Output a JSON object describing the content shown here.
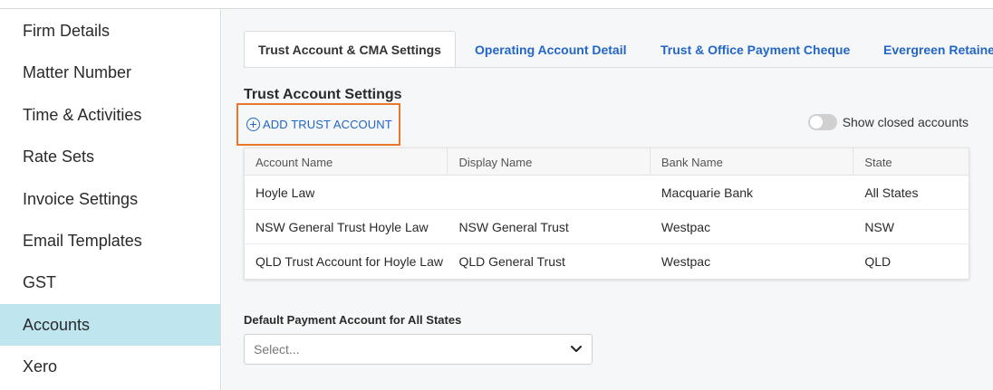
{
  "sidebar": {
    "items": [
      {
        "label": "Firm Details"
      },
      {
        "label": "Matter Number"
      },
      {
        "label": "Time & Activities"
      },
      {
        "label": "Rate Sets"
      },
      {
        "label": "Invoice Settings"
      },
      {
        "label": "Email Templates"
      },
      {
        "label": "GST"
      },
      {
        "label": "Accounts",
        "active": true
      },
      {
        "label": "Xero"
      }
    ]
  },
  "tabs": [
    {
      "label": "Trust Account & CMA Settings",
      "active": true
    },
    {
      "label": "Operating Account Detail"
    },
    {
      "label": "Trust & Office Payment Cheque"
    },
    {
      "label": "Evergreen Retainer"
    }
  ],
  "section": {
    "title": "Trust Account Settings",
    "add_button": "ADD TRUST ACCOUNT",
    "toggle_label": "Show closed accounts",
    "toggle_on": false
  },
  "table": {
    "headers": [
      "Account Name",
      "Display Name",
      "Bank Name",
      "State"
    ],
    "rows": [
      [
        "Hoyle Law",
        "",
        "Macquarie Bank",
        "All States"
      ],
      [
        "NSW General Trust Hoyle Law",
        "NSW General Trust",
        "Westpac",
        "NSW"
      ],
      [
        "QLD Trust Account for Hoyle Law",
        "QLD General Trust",
        "Westpac",
        "QLD"
      ]
    ]
  },
  "default_payment": {
    "label": "Default Payment Account for All States",
    "placeholder": "Select..."
  },
  "colors": {
    "accent_blue": "#2366c5",
    "active_sidebar": "#bfe6ef",
    "highlight_orange": "#e8772c"
  }
}
